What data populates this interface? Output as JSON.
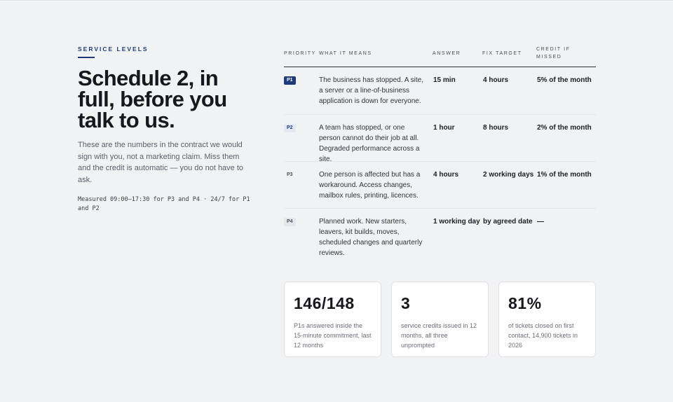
{
  "eyebrow": "SERVICE LEVELS",
  "headline": "Schedule 2, in full, before you talk to us.",
  "lede": "These are the numbers in the contract we would sign with you, not a marketing claim. Miss them and the credit is automatic — you do not have to ask.",
  "measured": "Measured 09:00–17:30 for P3 and P4 · 24/7 for P1 and P2",
  "table": {
    "headers": {
      "priority": "PRIORITY",
      "meaning": "WHAT IT MEANS",
      "answer": "ANSWER",
      "fix": "FIX TARGET",
      "credit": "CREDIT IF MISSED"
    },
    "rows": [
      {
        "priority": "P1",
        "meaning": "The business has stopped. A site, a server or a line-of-business application is down for everyone.",
        "answer": "15 min",
        "fix": "4 hours",
        "credit": "5% of the month"
      },
      {
        "priority": "P2",
        "meaning": "A team has stopped, or one person cannot do their job at all. Degraded performance across a site.",
        "answer": "1 hour",
        "fix": "8 hours",
        "credit": "2% of the month"
      },
      {
        "priority": "P3",
        "meaning": "One person is affected but has a workaround. Access changes, mailbox rules, printing, licences.",
        "answer": "4 hours",
        "fix": "2 working days",
        "credit": "1% of the month"
      },
      {
        "priority": "P4",
        "meaning": "Planned work. New starters, leavers, kit builds, moves, scheduled changes and quarterly reviews.",
        "answer": "1 working day",
        "fix": "by agreed date",
        "credit": "—"
      }
    ]
  },
  "stats": [
    {
      "value": "146/148",
      "desc": "P1s answered inside the 15-minute commitment, last 12 months"
    },
    {
      "value": "3",
      "desc": "service credits issued in 12 months, all three unprompted"
    },
    {
      "value": "81%",
      "desc": "of tickets closed on first contact, 14,900 tickets in 2026"
    }
  ],
  "colors": {
    "accent": "#1f3a7a",
    "background": "#f1f2f4",
    "card": "#ffffff"
  }
}
